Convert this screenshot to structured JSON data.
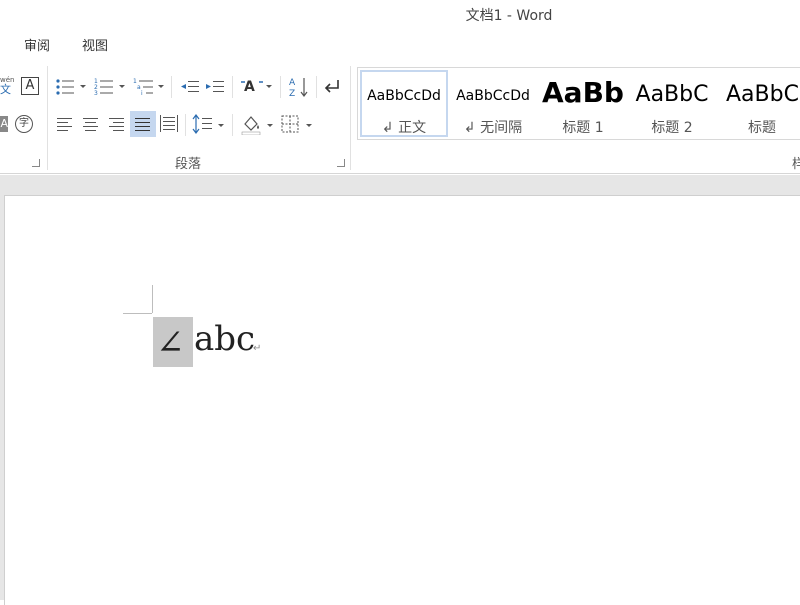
{
  "window": {
    "title": "文档1 - Word"
  },
  "tabs": [
    {
      "label": "审阅"
    },
    {
      "label": "视图"
    }
  ],
  "ribbon": {
    "font_group": {
      "pinyin_label": "wén",
      "pinyin_char": "文",
      "char_border_letter": "A",
      "enclose_char": "字",
      "shade_letter": "A"
    },
    "paragraph_group": {
      "label": "段落",
      "sort_az": "A↓Z"
    },
    "styles_group": {
      "items": [
        {
          "preview": "AaBbCcDd",
          "name": "↲ 正文",
          "selected": true
        },
        {
          "preview": "AaBbCcDd",
          "name": "↲ 无间隔",
          "selected": false
        },
        {
          "preview": "AaBb",
          "name": "标题 1",
          "selected": false
        },
        {
          "preview": "AaBbC",
          "name": "标题 2",
          "selected": false
        },
        {
          "preview": "AaBbC",
          "name": "标题",
          "selected": false
        }
      ],
      "label_fragment": "样"
    }
  },
  "document": {
    "symbol": "∠",
    "text": "abc",
    "paragraph_mark": "↵"
  },
  "colors": {
    "selection": "#c8c8c8",
    "gallery_selected_border": "#c5d7ef",
    "align_active": "#c5d7ef"
  }
}
